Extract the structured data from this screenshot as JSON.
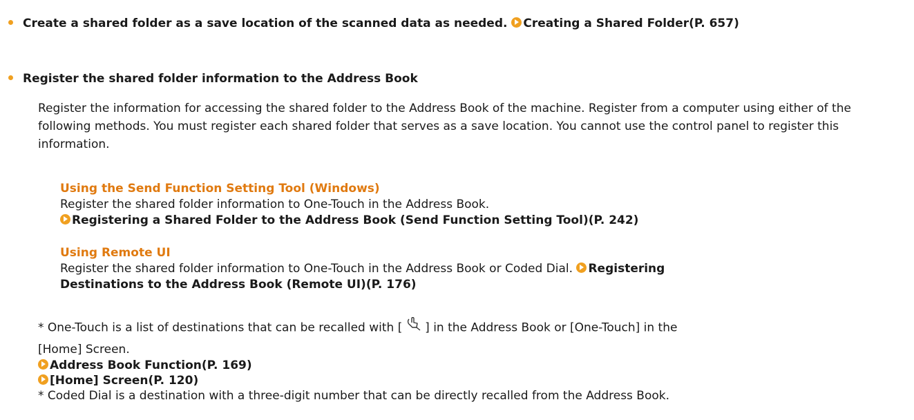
{
  "bullet1": {
    "text": "Create a shared folder as a save location of the scanned data as needed.",
    "link": "Creating a Shared Folder(P. 657)"
  },
  "bullet2": {
    "heading": "Register the shared folder information to the Address Book",
    "paragraph": "Register the information for accessing the shared folder to the Address Book of the machine. Register from a computer using either of the following methods. You must register each shared folder that serves as a save location. You cannot use the control panel to register this information."
  },
  "method1": {
    "title": "Using the Send Function Setting Tool (Windows)",
    "desc": "Register the shared folder information to One-Touch in the Address Book.",
    "link": "Registering a Shared Folder to the Address Book (Send Function Setting Tool)(P. 242)"
  },
  "method2": {
    "title": "Using Remote UI",
    "desc": "Register the shared folder information to One-Touch in the Address Book or Coded Dial.",
    "link_part1": "Registering",
    "link_part2": "Destinations to the Address Book (Remote UI)(P. 176)"
  },
  "note1": {
    "before": "* One-Touch is a list of destinations that can be recalled with [",
    "after": "] in the Address Book or [One-Touch] in the",
    "line2": "[Home] Screen.",
    "icon": "one-touch-hand-icon"
  },
  "links": {
    "address_book_function": "Address Book Function(P. 169)",
    "home_screen": "[Home] Screen(P. 120)"
  },
  "note2": "* Coded Dial is a destination with a three-digit number that can be directly recalled from the Address Book.",
  "colors": {
    "accent": "#f0a020",
    "subtitle": "#e07a10"
  }
}
